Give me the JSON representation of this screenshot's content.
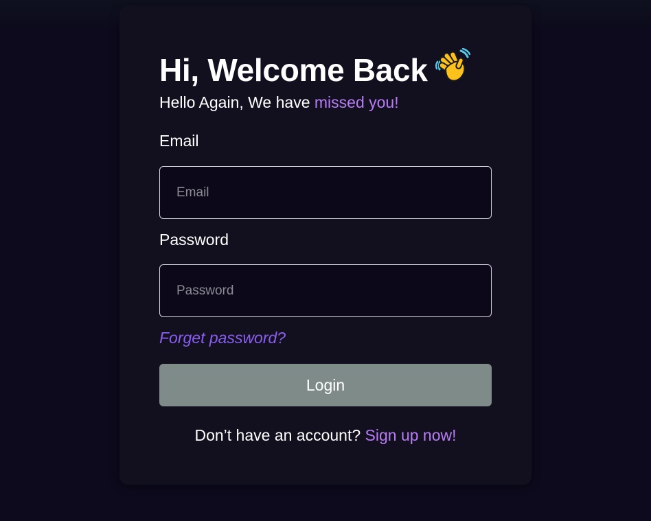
{
  "login": {
    "title": "Hi, Welcome Back",
    "title_icon": "waving-hand-icon",
    "subtitle_prefix": "Hello Again, We have ",
    "subtitle_accent": "missed you!",
    "email_label": "Email",
    "email_placeholder": "Email",
    "email_value": "",
    "password_label": "Password",
    "password_placeholder": "Password",
    "password_value": "",
    "forgot_label": "Forget password?",
    "login_label": "Login",
    "signup_prompt": "Don’t have an account? ",
    "signup_link": "Sign up now!"
  },
  "colors": {
    "background": "#0c0a1c",
    "card": "#12101f",
    "accent": "#b77cf5",
    "forgot_link": "#8a5ef0",
    "button": "#7f8b89"
  }
}
